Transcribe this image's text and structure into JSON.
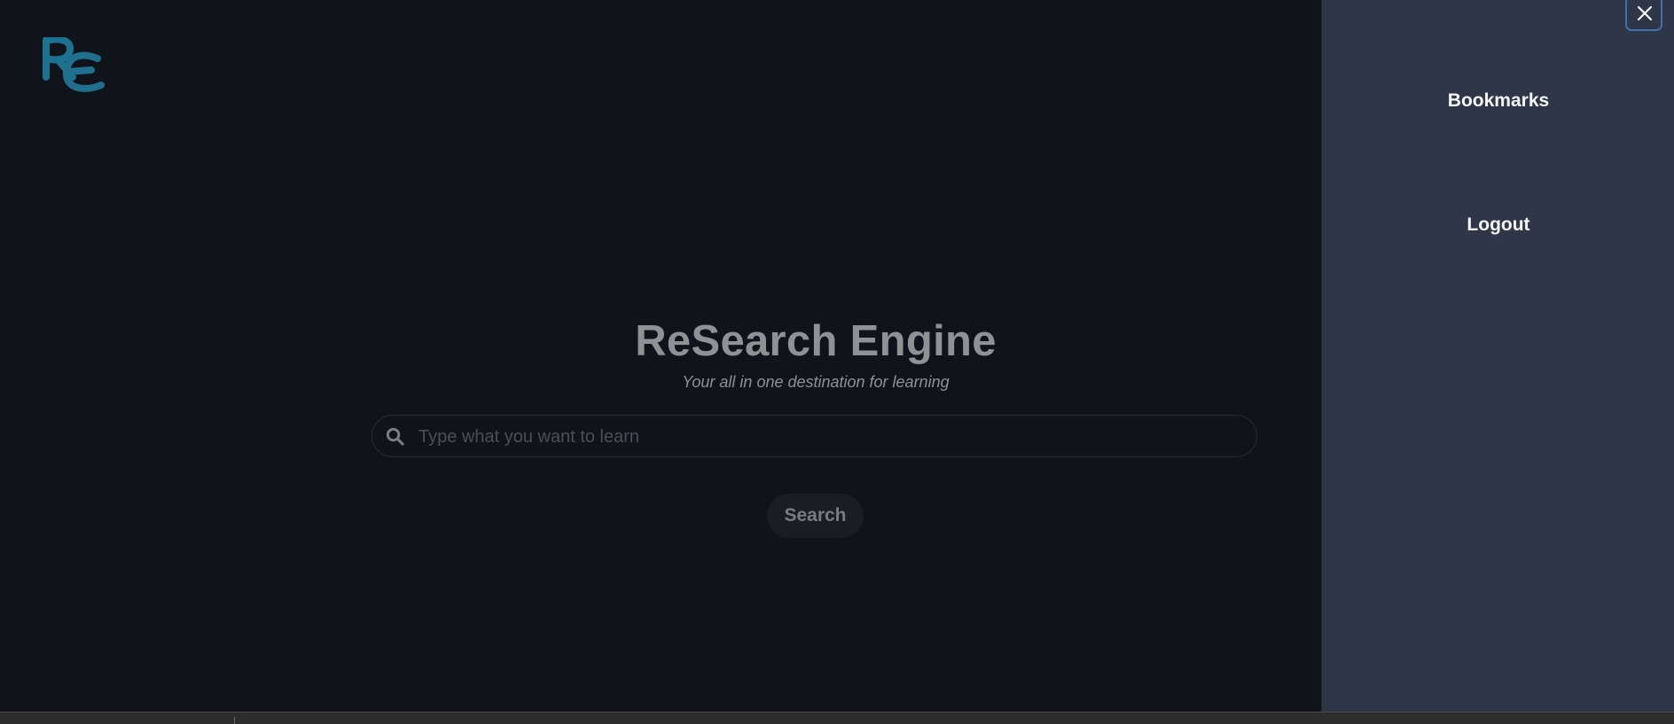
{
  "app": {
    "logo_text": "RE"
  },
  "main": {
    "title": "ReSearch Engine",
    "subtitle": "Your all in one destination for learning",
    "search": {
      "placeholder": "Type what you want to learn",
      "value": ""
    },
    "search_button_label": "Search"
  },
  "sidebar": {
    "items": [
      {
        "label": "Bookmarks"
      },
      {
        "label": "Logout"
      }
    ],
    "close_icon": "close-icon"
  },
  "colors": {
    "background": "#10131a",
    "sidebar": "#2e3647",
    "logo": "#1b7391",
    "focus_border": "#3c74b2",
    "muted_text": "#8f9195"
  }
}
